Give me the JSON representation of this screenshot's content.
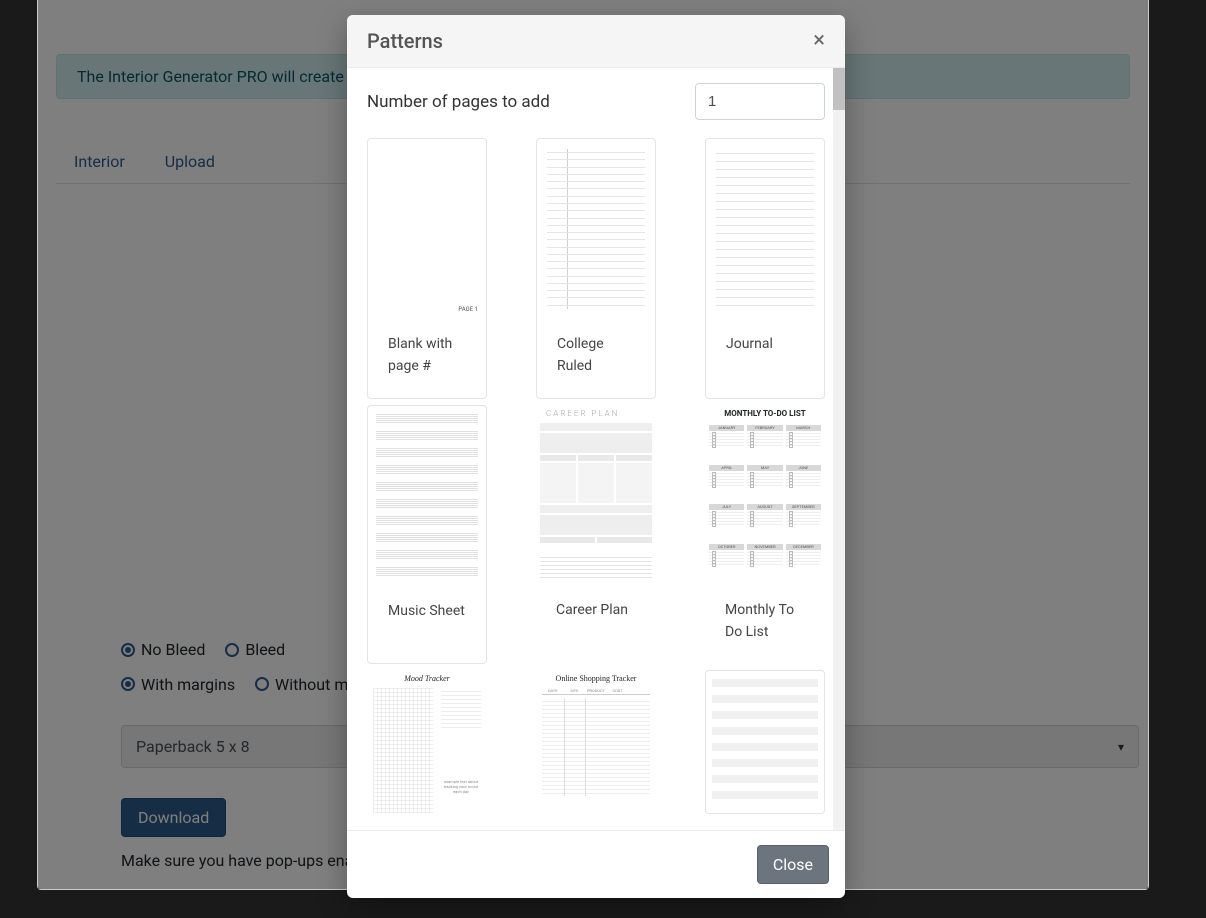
{
  "alert": "The Interior Generator PRO will create a ",
  "tabs": {
    "interior": "Interior",
    "upload": "Upload"
  },
  "options": {
    "bleed": {
      "no": "No Bleed",
      "yes": "Bleed"
    },
    "margins": {
      "with": "With margins",
      "without": "Without margins"
    },
    "size": "Paperback 5 x 8"
  },
  "download": "Download",
  "note": "Make sure you have pop-ups enabled",
  "modal": {
    "title": "Patterns",
    "pages_label": "Number of pages to add",
    "pages_value": "1",
    "patterns": {
      "blank": {
        "label": "Blank with page #",
        "page_marker": "PAGE 1"
      },
      "college": {
        "label": "College Ruled"
      },
      "journal": {
        "label": "Journal"
      },
      "music": {
        "label": "Music Sheet"
      },
      "career": {
        "label": "Career Plan",
        "heading": "CAREER PLAN"
      },
      "monthly": {
        "label": "Monthly To Do List",
        "heading": "MONTHLY TO-DO LIST",
        "months": [
          "JANUARY",
          "FEBRUARY",
          "MARCH",
          "APRIL",
          "MAY",
          "JUNE",
          "JULY",
          "AUGUST",
          "SEPTEMBER",
          "OCTOBER",
          "NOVEMBER",
          "DECEMBER"
        ]
      },
      "mood": {
        "heading": "Mood Tracker",
        "note_text": "example text about tracking your mood each day"
      },
      "shopping": {
        "heading": "Online Shopping Tracker",
        "columns": [
          "DATE",
          "SITE",
          "PRODUCT",
          "COST",
          ""
        ]
      },
      "stripe": {}
    },
    "close": "Close"
  }
}
